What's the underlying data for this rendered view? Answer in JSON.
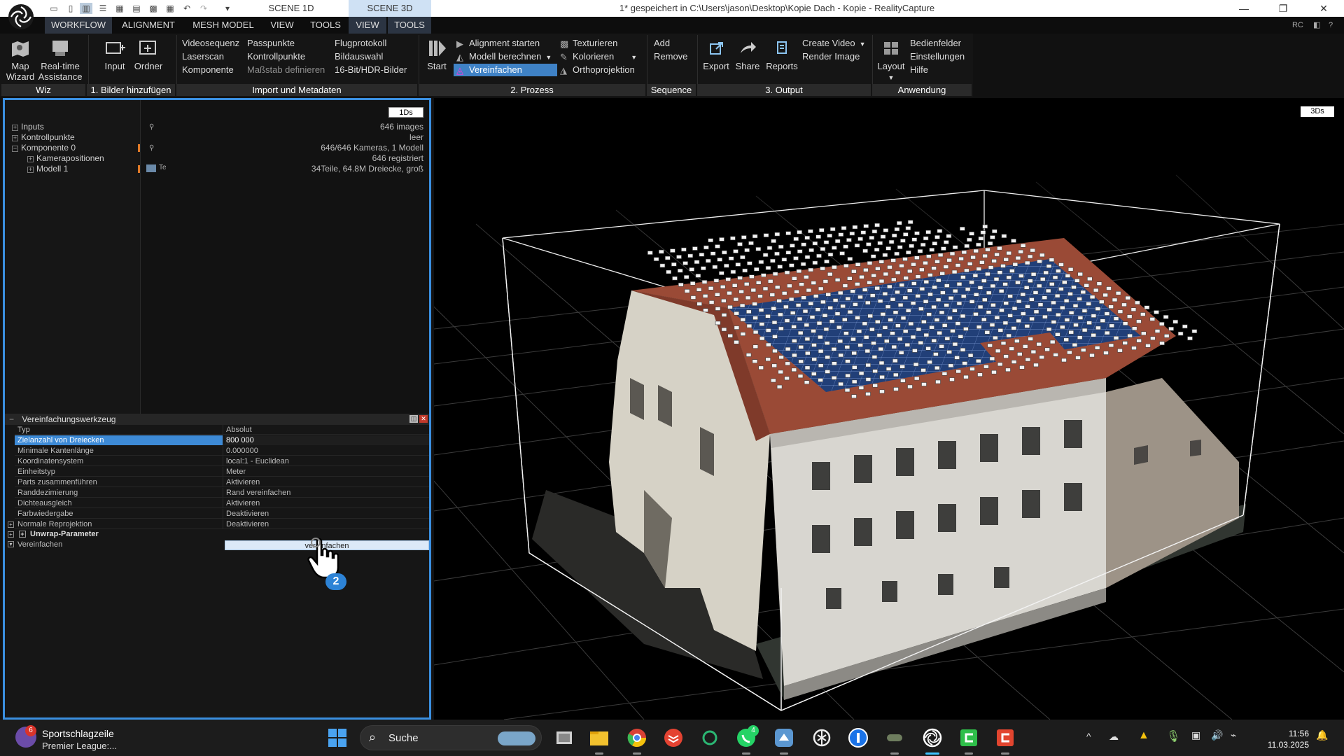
{
  "titlebar": {
    "scene_tabs": [
      "SCENE 1D",
      "SCENE 3D"
    ],
    "window_title": "1* gespeichert in C:\\Users\\jason\\Desktop\\Kopie Dach - Kopie - RealityCapture",
    "minimize": "—",
    "maximize": "❐",
    "close": "✕"
  },
  "menu": {
    "items": [
      "WORKFLOW",
      "ALIGNMENT",
      "MESH MODEL",
      "VIEW",
      "TOOLS",
      "VIEW",
      "TOOLS"
    ],
    "right_label": "RC"
  },
  "ribbon": {
    "map_wizard": "Map Wizard",
    "map_wizard_l1": "Map",
    "map_wizard_l2": "Wizard",
    "realtime_l1": "Real-time",
    "realtime_l2": "Assistance",
    "input": "Input",
    "ordner": "Ordner",
    "import_col1": [
      "Videosequenz",
      "Laserscan",
      "Komponente"
    ],
    "import_col2": [
      "Passpunkte",
      "Kontrollpunkte",
      "Maßstab definieren"
    ],
    "import_col3": [
      "Flugprotokoll",
      "Bildauswahl",
      "16-Bit/HDR-Bilder"
    ],
    "start": "Start",
    "process_col1": [
      "Alignment starten",
      "Modell berechnen",
      "Vereinfachen"
    ],
    "process_col2": [
      "Texturieren",
      "Kolorieren",
      "Orthoprojektion"
    ],
    "seq_add": "Add",
    "seq_remove": "Remove",
    "export": "Export",
    "share": "Share",
    "reports": "Reports",
    "create_video": "Create Video",
    "render_image": "Render Image",
    "layout": "Layout",
    "app_col": [
      "Bedienfelder",
      "Einstellungen",
      "Hilfe"
    ],
    "groups": [
      "Wiz",
      "1. Bilder hinzufügen",
      "Import und Metadaten",
      "2. Prozess",
      "Sequence",
      "3. Output",
      "Anwendung"
    ]
  },
  "tree": {
    "badge": "1Ds",
    "items": [
      {
        "label": "Inputs",
        "value": "646 images"
      },
      {
        "label": "Kontrollpunkte",
        "value": "leer"
      },
      {
        "label": "Komponente 0",
        "value": "646/646 Kameras, 1 Modell"
      },
      {
        "label": "Kamerapositionen",
        "value": "646 registriert"
      },
      {
        "label": "Modell 1",
        "value": "34Teile, 64.8M Dreiecke, groß"
      }
    ],
    "model_tag": "Te"
  },
  "tool": {
    "title": "Vereinfachungswerkzeug",
    "rows": [
      {
        "k": "Typ",
        "v": "Absolut"
      },
      {
        "k": "Zielanzahl von Dreiecken",
        "v": "800 000"
      },
      {
        "k": "Minimale Kantenlänge",
        "v": "0.000000"
      },
      {
        "k": "Koordinatensystem",
        "v": "local:1 - Euclidean"
      },
      {
        "k": "Einheitstyp",
        "v": "Meter"
      },
      {
        "k": "Parts zusammenführen",
        "v": "Aktivieren"
      },
      {
        "k": "Randdezimierung",
        "v": "Rand vereinfachen"
      },
      {
        "k": "Dichteausgleich",
        "v": "Aktivieren"
      },
      {
        "k": "Farbwiedergabe",
        "v": "Deaktivieren"
      },
      {
        "k": "Normale Reprojektion",
        "v": "Deaktivieren"
      }
    ],
    "unwrap": "Unwrap-Parameter",
    "simplify_label": "Vereinfachen",
    "simplify_button": "vereinfachen",
    "cursor_badge": "2"
  },
  "viewport": {
    "badge": "3Ds"
  },
  "taskbar": {
    "news_title": "Sportschlagzeile",
    "news_sub": "Premier League:...",
    "news_badge": "6",
    "search": "Suche",
    "whatsapp_badge": "4",
    "time": "11:56",
    "date": "11.03.2025"
  },
  "colors": {
    "accent": "#3a8fe0",
    "selection": "#3d8ad6",
    "roof": "#9a4a36",
    "solar": "#1d3a6e",
    "facade": "#d9d6cf"
  }
}
